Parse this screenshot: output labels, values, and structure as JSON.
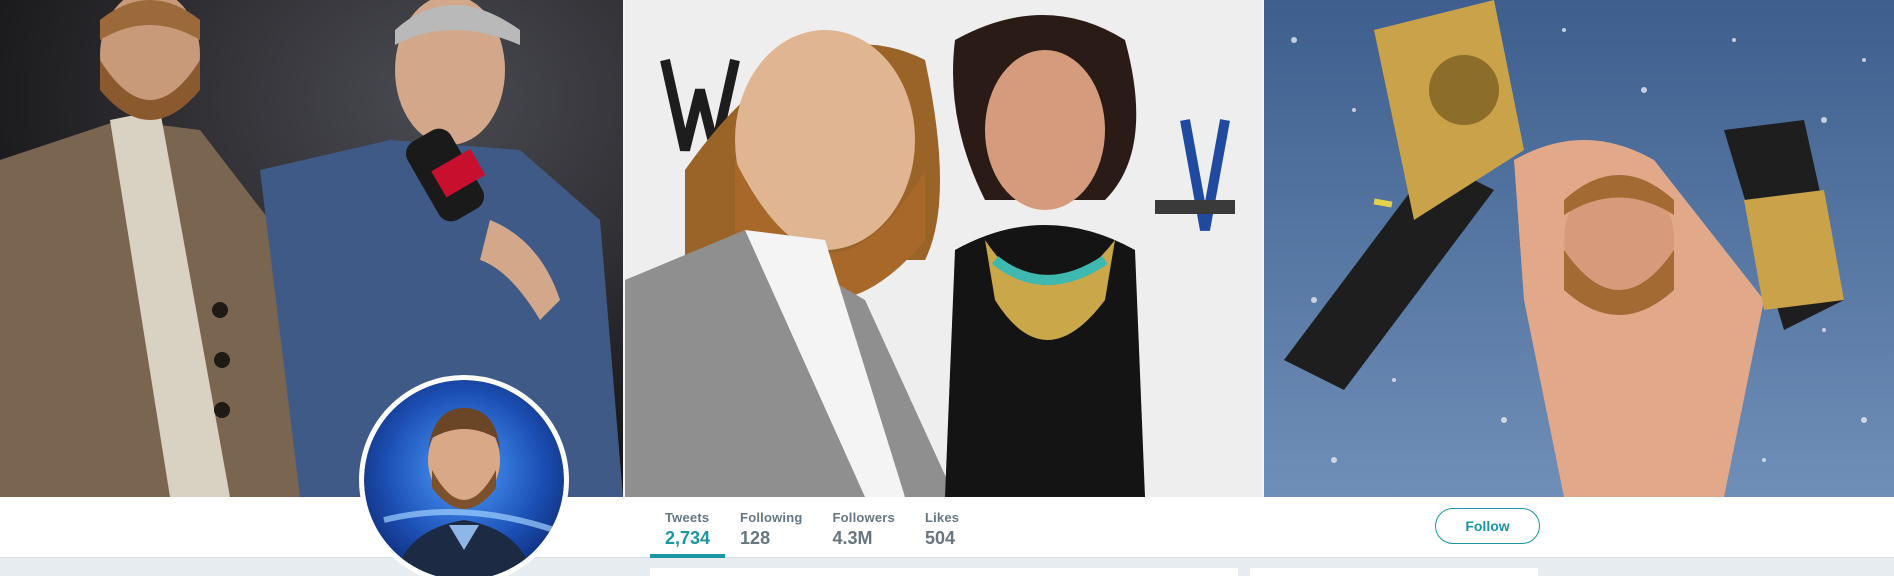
{
  "banner": {
    "panels": [
      {
        "name": "banner-photo-left",
        "colors": {
          "bg": "#2a2a2c",
          "accent": "#3f5a86"
        }
      },
      {
        "name": "banner-photo-center",
        "colors": {
          "bg": "#f1f1f1",
          "accent": "#8a4f1c"
        }
      },
      {
        "name": "banner-photo-right",
        "colors": {
          "bg": "#5a7fae",
          "accent": "#c9a24a"
        }
      }
    ]
  },
  "profile": {
    "avatar_icon": "profile-avatar",
    "stats": [
      {
        "label": "Tweets",
        "value": "2,734",
        "active": true
      },
      {
        "label": "Following",
        "value": "128",
        "active": false
      },
      {
        "label": "Followers",
        "value": "4.3M",
        "active": false
      },
      {
        "label": "Likes",
        "value": "504",
        "active": false
      }
    ],
    "follow_label": "Follow"
  },
  "colors": {
    "accent": "#1b95a0",
    "muted_text": "#657786",
    "page_bg": "#e6ecf0",
    "nav_bg": "#ffffff"
  }
}
